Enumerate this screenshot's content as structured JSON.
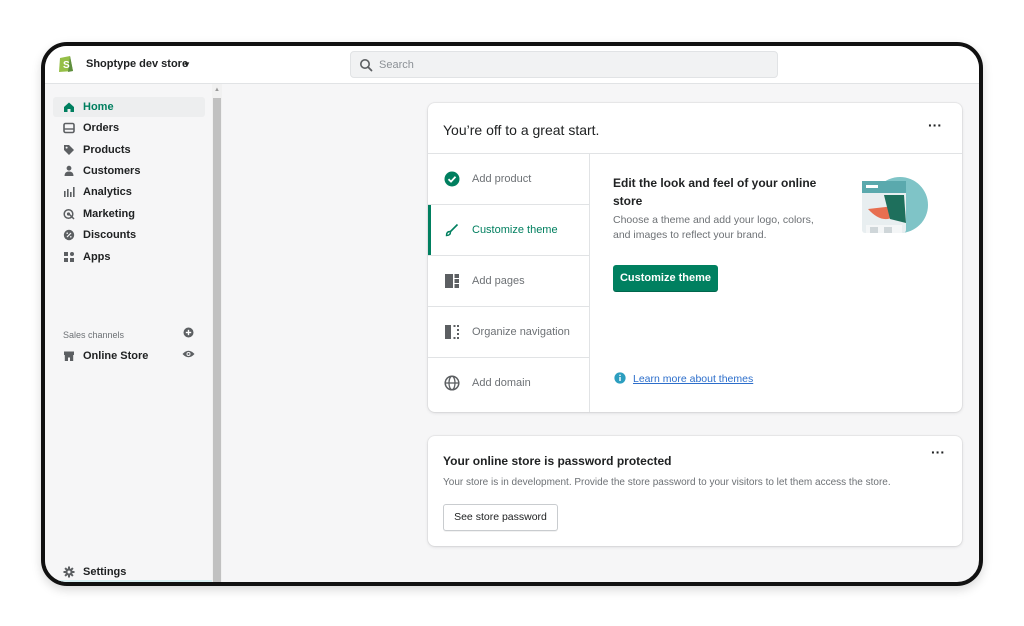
{
  "topbar": {
    "store_name": "Shoptype dev store",
    "search_placeholder": "Search"
  },
  "sidebar": {
    "items": [
      {
        "label": "Home",
        "icon": "home-icon",
        "active": true
      },
      {
        "label": "Orders",
        "icon": "orders-icon"
      },
      {
        "label": "Products",
        "icon": "tag-icon"
      },
      {
        "label": "Customers",
        "icon": "person-icon"
      },
      {
        "label": "Analytics",
        "icon": "bar-chart-icon"
      },
      {
        "label": "Marketing",
        "icon": "target-icon"
      },
      {
        "label": "Discounts",
        "icon": "discount-icon"
      },
      {
        "label": "Apps",
        "icon": "apps-icon"
      }
    ],
    "sales_channels_label": "Sales channels",
    "online_store_label": "Online Store",
    "settings_label": "Settings"
  },
  "setup_card": {
    "title": "You’re off to a great start.",
    "steps": [
      {
        "label": "Add product",
        "icon": "check-circle-icon",
        "done": true
      },
      {
        "label": "Customize theme",
        "icon": "brush-icon",
        "active": true
      },
      {
        "label": "Add pages",
        "icon": "pages-icon"
      },
      {
        "label": "Organize navigation",
        "icon": "navigation-icon"
      },
      {
        "label": "Add domain",
        "icon": "globe-icon"
      }
    ],
    "detail_title": "Edit the look and feel of your online store",
    "detail_desc": "Choose a theme and add your logo, colors, and images to reflect your brand.",
    "primary_button": "Customize theme",
    "learn_link": "Learn more about themes"
  },
  "password_card": {
    "title": "Your online store is password protected",
    "text": "Your store is in development. Provide the store password to your visitors to let them access the store.",
    "button": "See store password"
  },
  "colors": {
    "accent": "#008060",
    "link": "#2c6ecb",
    "background": "#f6f6f7"
  }
}
